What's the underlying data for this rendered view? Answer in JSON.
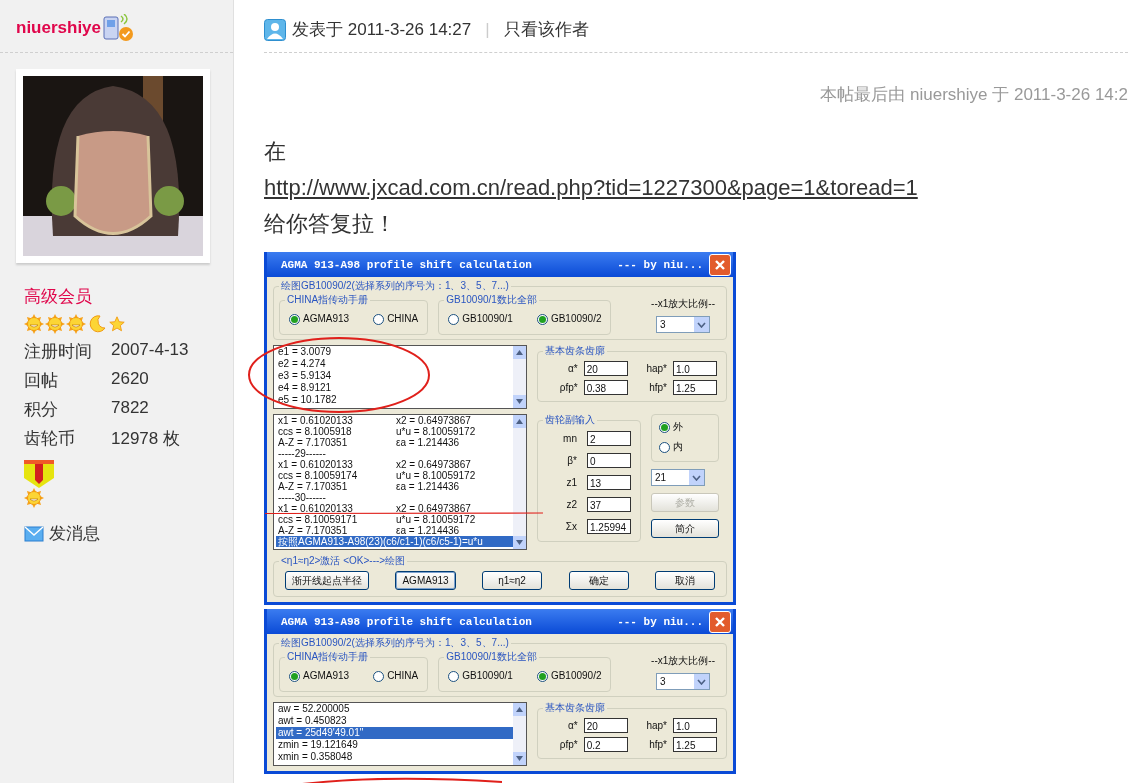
{
  "author": {
    "name": "niuershiye",
    "rank": "高级会员",
    "rank_icons": [
      {
        "kind": "sun"
      },
      {
        "kind": "sun"
      },
      {
        "kind": "sun"
      },
      {
        "kind": "moon"
      },
      {
        "kind": "star"
      }
    ],
    "stats": [
      {
        "label": "注册时间",
        "value": "2007-4-13"
      },
      {
        "label": "回帖",
        "value": "2620"
      },
      {
        "label": "积分",
        "value": "7822"
      },
      {
        "label": "齿轮币",
        "value": "12978 枚"
      }
    ],
    "medals": [
      {
        "kind": "medal"
      },
      {
        "kind": "sun"
      }
    ],
    "message_link": "发消息"
  },
  "post": {
    "posted": "发表于 2011-3-26 14:27",
    "separator": "|",
    "author_only": "只看该作者",
    "edit_note": "本帖最后由 niuershiye 于 2011-3-26 14:2",
    "body": [
      {
        "kind": "text",
        "text": "在"
      },
      {
        "kind": "link",
        "text": "http://www.jxcad.com.cn/read.php?tid=1227300&page=1&toread=1"
      },
      {
        "kind": "text",
        "text": "给你答复拉！"
      }
    ],
    "dialogs": [
      {
        "title": "AGMA 913-A98 profile shift calculation",
        "byline": "--- by niu...",
        "group_title": "绘图GB10090/2(选择系列的序号为：1、3、5、7...)",
        "option_groups": [
          {
            "title": "CHINA指传动手册",
            "options": [
              {
                "label": "AGMA913",
                "selected": true
              },
              {
                "label": "CHINA",
                "selected": false
              }
            ]
          },
          {
            "title": "GB10090/1数比全部",
            "options": [
              {
                "label": "GB10090/1",
                "selected": false
              },
              {
                "label": "GB10090/2",
                "selected": true
              }
            ]
          }
        ],
        "scale": {
          "label": "--x1放大比例--",
          "value": "3"
        },
        "coef_list": [
          {
            "cells": [
              "e1 = 3.0079"
            ],
            "selected": false
          },
          {
            "cells": [
              "e2 = 4.274"
            ],
            "selected": false
          },
          {
            "cells": [
              "e3 = 5.9134"
            ],
            "selected": false
          },
          {
            "cells": [
              "e4 = 8.9121"
            ],
            "selected": false
          },
          {
            "cells": [
              "e5 = 10.1782"
            ],
            "selected": false
          }
        ],
        "rack": {
          "title": "基本齿条齿廓",
          "fields": [
            {
              "label": "α*",
              "value": "20"
            },
            {
              "label": "hap*",
              "value": "1.0"
            },
            {
              "label": "ρfp*",
              "value": "0.38"
            },
            {
              "label": "hfp*",
              "value": "1.25"
            }
          ]
        },
        "results": [
          {
            "cells": [
              "x1 = 0.61020133",
              "x2 = 0.64973867"
            ],
            "selected": false
          },
          {
            "cells": [
              "ccs = 8.1005918",
              "u*u = 8.10059172"
            ],
            "selected": false
          },
          {
            "cells": [
              "A-Z = 7.170351",
              "εa = 1.214436"
            ],
            "selected": false
          },
          {
            "cells": [
              "-----29------"
            ],
            "selected": false
          },
          {
            "cells": [
              "x1 = 0.61020133",
              "x2 = 0.64973867"
            ],
            "selected": false
          },
          {
            "cells": [
              "ccs = 8.10059174",
              "u*u = 8.10059172"
            ],
            "selected": false
          },
          {
            "cells": [
              "A-Z = 7.170351",
              "εa = 1.214436"
            ],
            "selected": false
          },
          {
            "cells": [
              "-----30------"
            ],
            "selected": false
          },
          {
            "cells": [
              "x1 = 0.61020133",
              "x2 = 0.64973867"
            ],
            "selected": false
          },
          {
            "cells": [
              "ccs = 8.10059171",
              "u*u = 8.10059172"
            ],
            "selected": false
          },
          {
            "cells": [
              "A-Z = 7.170351",
              "εa = 1.214436"
            ],
            "selected": false
          },
          {
            "cells": [
              "按照AGMA913-A98(23)(c6/c1-1)(c6/c5-1)=u*u"
            ],
            "selected": true
          }
        ],
        "pair": {
          "title": "齿轮副输入",
          "fields": [
            {
              "label": "mn",
              "value": "2"
            },
            {
              "label": "β*",
              "value": "0"
            },
            {
              "label": "z1",
              "value": "13"
            },
            {
              "label": "z2",
              "value": "37"
            },
            {
              "label": "Σx",
              "value": "1.25994"
            }
          ]
        },
        "side": {
          "options": [
            {
              "label": "外",
              "selected": true
            },
            {
              "label": "内",
              "selected": false
            }
          ],
          "dropdown": "21",
          "buttons": [
            {
              "label": "参数",
              "disabled": true
            },
            {
              "label": "简介",
              "disabled": false
            }
          ]
        },
        "actions": {
          "title": "<η1≈η2>激活 <OK>--->绘图",
          "buttons": [
            {
              "label": "渐开线起点半径",
              "selected": false
            },
            {
              "label": "AGMA913",
              "selected": true
            },
            {
              "label": "η1≈η2",
              "selected": false
            },
            {
              "label": "确定",
              "selected": false
            },
            {
              "label": "取消",
              "selected": false
            }
          ]
        },
        "markup": [
          {
            "kind": "ellipse"
          },
          {
            "kind": "line"
          }
        ]
      },
      {
        "title": "AGMA 913-A98 profile shift calculation",
        "byline": "--- by niu...",
        "group_title": "绘图GB10090/2(选择系列的序号为：1、3、5、7...)",
        "option_groups": [
          {
            "title": "CHINA指传动手册",
            "options": [
              {
                "label": "AGMA913",
                "selected": true
              },
              {
                "label": "CHINA",
                "selected": false
              }
            ]
          },
          {
            "title": "GB10090/1数比全部",
            "options": [
              {
                "label": "GB10090/1",
                "selected": false
              },
              {
                "label": "GB10090/2",
                "selected": true
              }
            ]
          }
        ],
        "scale": {
          "label": "--x1放大比例--",
          "value": "3"
        },
        "coef_list": [
          {
            "cells": [
              "aw = 52.200005"
            ],
            "selected": false
          },
          {
            "cells": [
              "awt = 0.450823"
            ],
            "selected": false
          },
          {
            "cells": [
              "awt = 25d49'49.01\""
            ],
            "selected": true
          },
          {
            "cells": [
              "zmin = 19.121649"
            ],
            "selected": false
          },
          {
            "cells": [
              "xmin = 0.358048"
            ],
            "selected": false
          }
        ],
        "rack": {
          "title": "基本齿条齿廓",
          "fields": [
            {
              "label": "α*",
              "value": "20"
            },
            {
              "label": "hap*",
              "value": "1.0"
            },
            {
              "label": "ρfp*",
              "value": "0.2"
            },
            {
              "label": "hfp*",
              "value": "1.25"
            }
          ]
        },
        "markup": [
          {
            "kind": "arc"
          }
        ]
      }
    ]
  }
}
